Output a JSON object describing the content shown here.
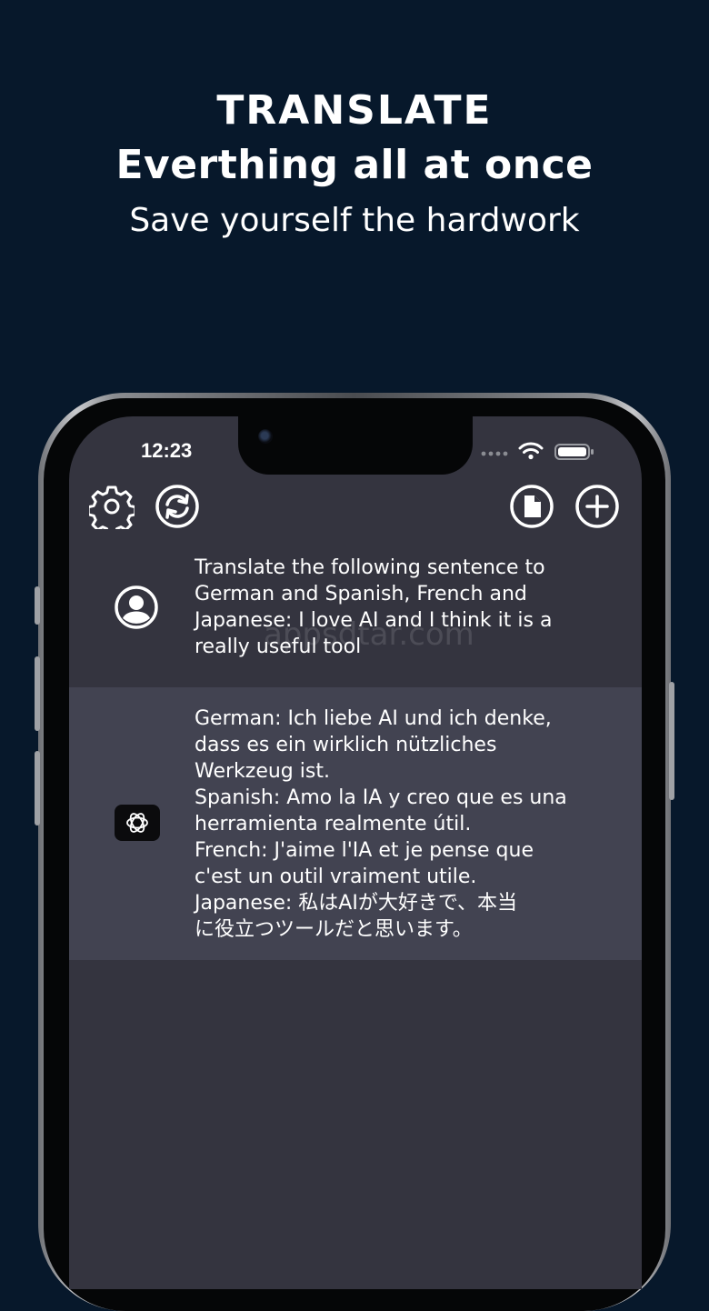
{
  "promo": {
    "line1": "TRANSLATE",
    "line2": "Everthing all at once",
    "line3": "Save yourself the hardwork"
  },
  "status_bar": {
    "time": "12:23"
  },
  "toolbar": {
    "settings_icon": "gear-icon",
    "refresh_icon": "refresh-icon",
    "document_icon": "document-icon",
    "add_icon": "plus-icon"
  },
  "chat": {
    "user_message": "Translate the following sentence to\nGerman and Spanish, French and\nJapanese: I love AI and I think it is a\nreally useful tool",
    "bot_message": "German: Ich liebe AI und ich denke,\ndass es ein wirklich nützliches\nWerkzeug ist.\nSpanish: Amo la IA y creo que es una\nherramienta realmente útil.\nFrench: J'aime l'IA et je pense que\nc'est un outil vraiment utile.\nJapanese: 私はAIが大好きで、本当\nに役立つツールだと思います。"
  },
  "watermark": "appsdtar.com",
  "colors": {
    "background": "#07182b",
    "screen": "#34343f",
    "bot_row": "#424351",
    "text": "#ffffff"
  }
}
